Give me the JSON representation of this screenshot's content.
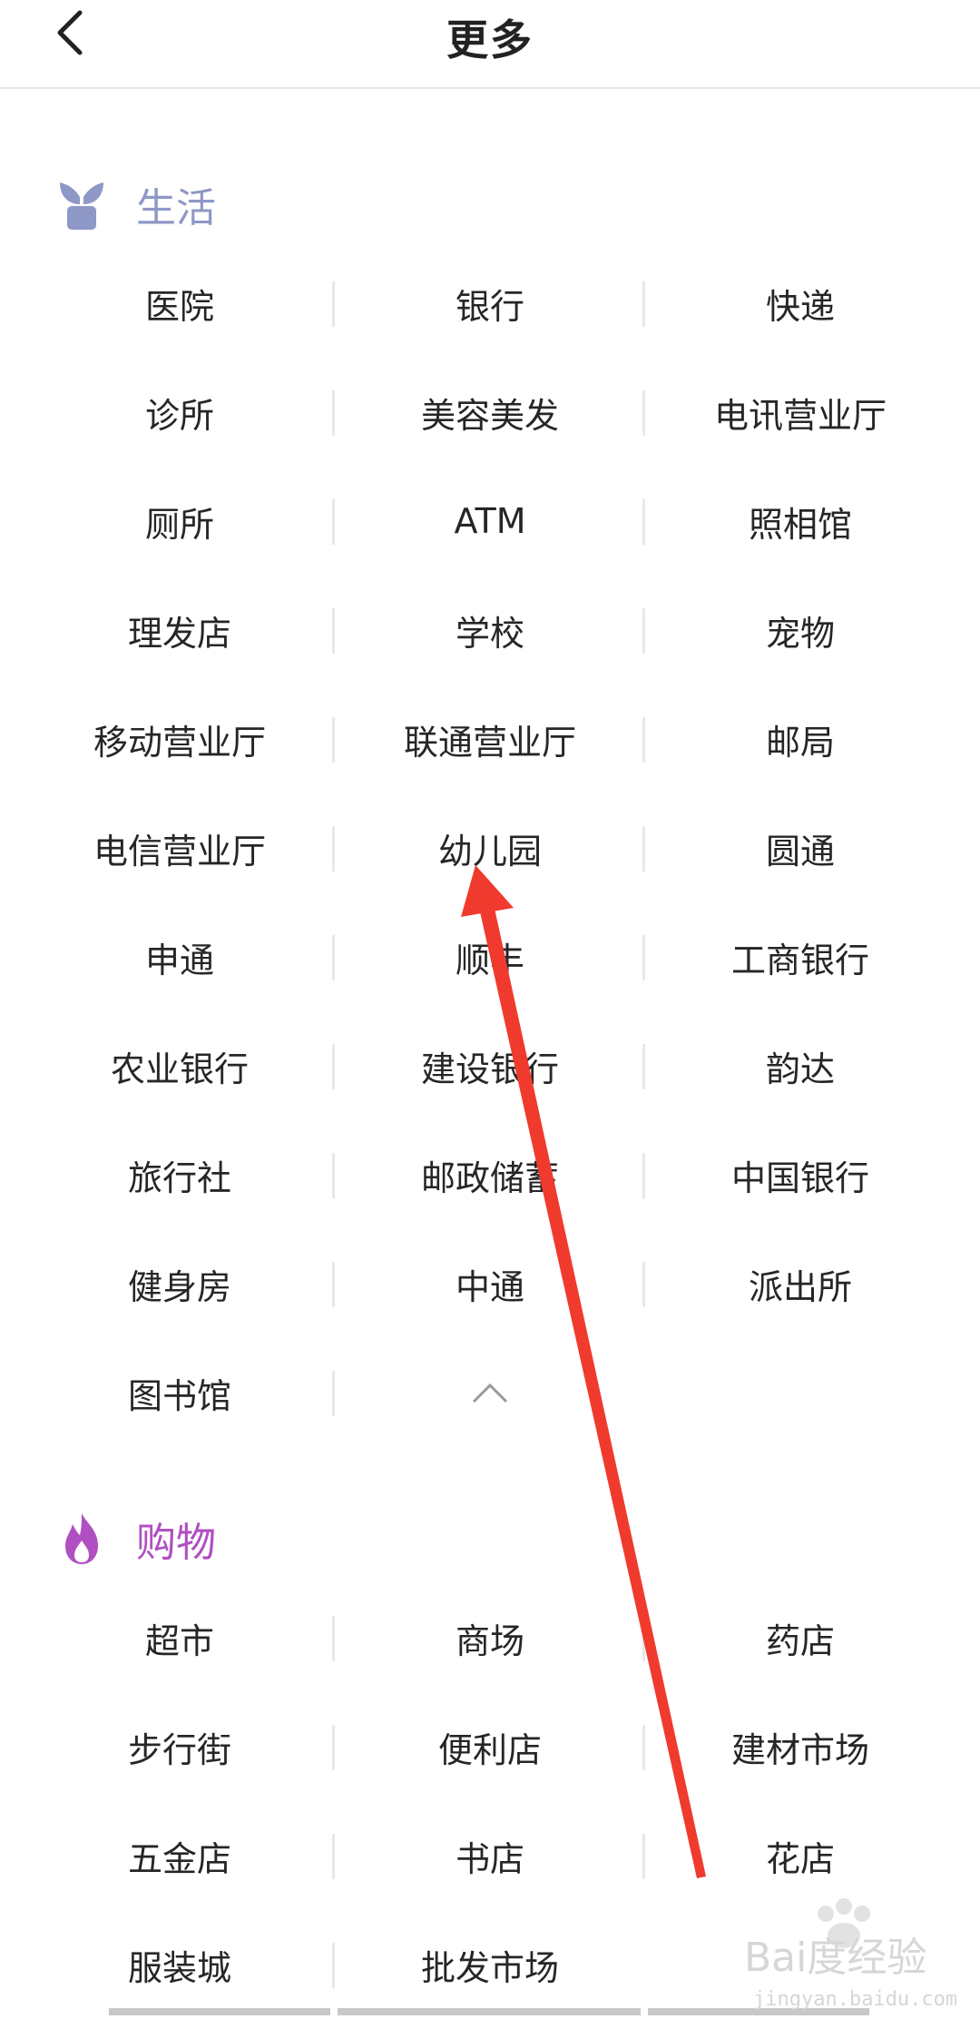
{
  "header": {
    "title": "更多",
    "back_icon": "chevron-left-icon"
  },
  "sections": {
    "life": {
      "title": "生活",
      "icon": "sprout-icon",
      "color": "#8e98c6",
      "rows": [
        [
          "医院",
          "银行",
          "快递"
        ],
        [
          "诊所",
          "美容美发",
          "电讯营业厅"
        ],
        [
          "厕所",
          "ATM",
          "照相馆"
        ],
        [
          "理发店",
          "学校",
          "宠物"
        ],
        [
          "移动营业厅",
          "联通营业厅",
          "邮局"
        ],
        [
          "电信营业厅",
          "幼儿园",
          "圆通"
        ],
        [
          "申通",
          "顺丰",
          "工商银行"
        ],
        [
          "农业银行",
          "建设银行",
          "韵达"
        ],
        [
          "旅行社",
          "邮政储蓄",
          "中国银行"
        ],
        [
          "健身房",
          "中通",
          "派出所"
        ],
        [
          "图书馆",
          "",
          ""
        ]
      ],
      "collapse_icon": "chevron-up-icon"
    },
    "shopping": {
      "title": "购物",
      "icon": "flame-icon",
      "color": "#b04fc2",
      "rows": [
        [
          "超市",
          "商场",
          "药店"
        ],
        [
          "步行街",
          "便利店",
          "建材市场"
        ],
        [
          "五金店",
          "书店",
          "花店"
        ],
        [
          "服装城",
          "批发市场",
          ""
        ]
      ]
    }
  },
  "annotation": {
    "icon": "red-arrow-icon",
    "color": "#f03a2e"
  },
  "watermark": {
    "text": "Bai度经验",
    "sub": "jingyan.baidu.com"
  }
}
